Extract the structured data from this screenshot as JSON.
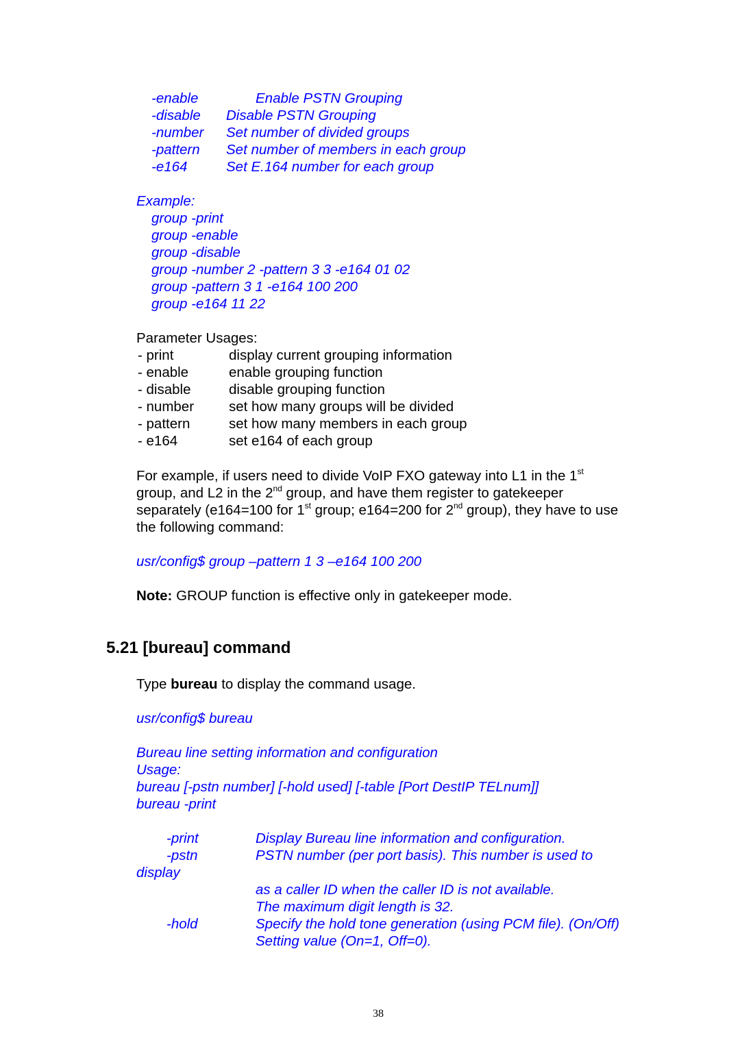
{
  "group_options": [
    {
      "flag": "-enable",
      "desc": "Enable PSTN Grouping"
    },
    {
      "flag": "-disable",
      "desc": "Disable PSTN Grouping"
    },
    {
      "flag": "-number",
      "desc": "Set number of divided groups"
    },
    {
      "flag": "-pattern",
      "desc": "Set number of members in each group"
    },
    {
      "flag": "-e164",
      "desc": "Set E.164 number for each group"
    }
  ],
  "example": {
    "label": "Example:",
    "lines": [
      "group -print",
      "group -enable",
      "group -disable",
      "group -number 2 -pattern 3 3 -e164 01 02",
      "group -pattern 3 1 -e164 100 200",
      "group -e164 11 22"
    ]
  },
  "parameter_usages": {
    "title": "Parameter Usages:",
    "rows": [
      {
        "param": "- print",
        "desc": "display current grouping information"
      },
      {
        "param": "- enable",
        "desc": "enable grouping function"
      },
      {
        "param": "- disable",
        "desc": "disable grouping function"
      },
      {
        "param": "- number",
        "desc": "set how many groups will be divided"
      },
      {
        "param": "- pattern",
        "desc": "set how many members in each group"
      },
      {
        "param": "- e164",
        "desc": "set e164 of each group"
      }
    ]
  },
  "paragraph": {
    "l1a": "For example, if users need to divide VoIP FXO gateway into L1 in the 1",
    "l1sup": "st",
    "l2a": "group, and L2 in the 2",
    "l2sup": "nd",
    "l2b": " group, and have them register to gatekeeper",
    "l3a": "separately (e164=100 for 1",
    "l3sup1": "st",
    "l3b": " group; e164=200 for 2",
    "l3sup2": "nd",
    "l3c": " group), they have to use",
    "l4": "the following command:"
  },
  "command_example": "usr/config$ group –pattern 1 3 –e164 100 200",
  "note": {
    "label": "Note:",
    "text": " GROUP function is effective only in gatekeeper mode."
  },
  "section": {
    "heading": "5.21 [bureau] command",
    "intro_a": "Type ",
    "intro_bold": "bureau",
    "intro_b": " to display the command usage.",
    "command": "usr/config$ bureau",
    "usage_lines": [
      "Bureau line setting information and configuration",
      "Usage:",
      "bureau [-pstn number] [-hold used] [-table [Port DestIP TELnum]]",
      "bureau -print"
    ],
    "options": [
      {
        "flag": "-print",
        "desc": "Display Bureau line information and configuration."
      },
      {
        "flag": "-pstn",
        "desc": "PSTN number (per port basis). This number is used to"
      },
      {
        "flag": "display",
        "desc": ""
      },
      {
        "flag": "",
        "desc": "as a caller ID when the caller ID is not available."
      },
      {
        "flag": "",
        "desc": "The maximum digit length is 32."
      },
      {
        "flag": "-hold",
        "desc": "Specify the hold tone generation (using PCM file). (On/Off)"
      },
      {
        "flag": "",
        "desc": "Setting value (On=1, Off=0)."
      }
    ]
  },
  "page_number": "38"
}
